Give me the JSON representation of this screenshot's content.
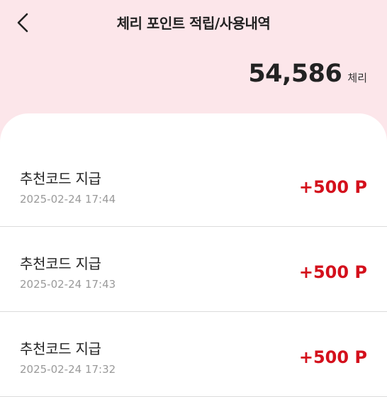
{
  "header": {
    "back_icon": "chevron-left-icon",
    "title": "체리 포인트 적립/사용내역"
  },
  "balance": {
    "value": "54,586",
    "unit": "체리"
  },
  "colors": {
    "top_background": "#fce6ea",
    "amount": "#d4101c"
  },
  "transactions": [
    {
      "title": "추천코드 지급",
      "date": "2025-02-24 17:44",
      "amount": "+500 P"
    },
    {
      "title": "추천코드 지급",
      "date": "2025-02-24 17:43",
      "amount": "+500 P"
    },
    {
      "title": "추천코드 지급",
      "date": "2025-02-24 17:32",
      "amount": "+500 P"
    }
  ]
}
